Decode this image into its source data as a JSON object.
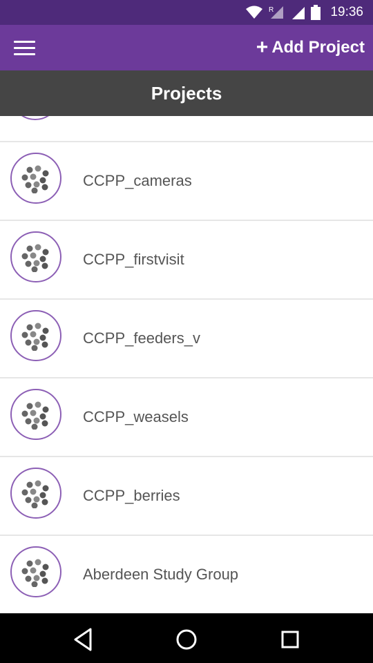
{
  "status_bar": {
    "time": "19:36",
    "icons": [
      "wifi-icon",
      "signal-roaming-icon",
      "battery-icon"
    ],
    "roaming_label": "R"
  },
  "app_bar": {
    "menu_icon": "hamburger-menu-icon",
    "add_label": "Add Project",
    "add_icon": "plus-icon"
  },
  "title_bar": {
    "title": "Projects"
  },
  "projects": [
    {
      "name": "CCPP_cameras"
    },
    {
      "name": "CCPP_firstvisit"
    },
    {
      "name": "CCPP_feeders_v"
    },
    {
      "name": "CCPP_weasels"
    },
    {
      "name": "CCPP_berries"
    },
    {
      "name": "Aberdeen Study Group"
    }
  ],
  "nav_bar": {
    "icons": [
      "back-triangle-icon",
      "home-circle-icon",
      "recents-square-icon"
    ]
  },
  "colors": {
    "status_bar": "#4e2a7a",
    "app_bar": "#6c3a9a",
    "title_bar": "#454545",
    "avatar_border": "#8c5fb5",
    "nav_bar": "#000000"
  }
}
